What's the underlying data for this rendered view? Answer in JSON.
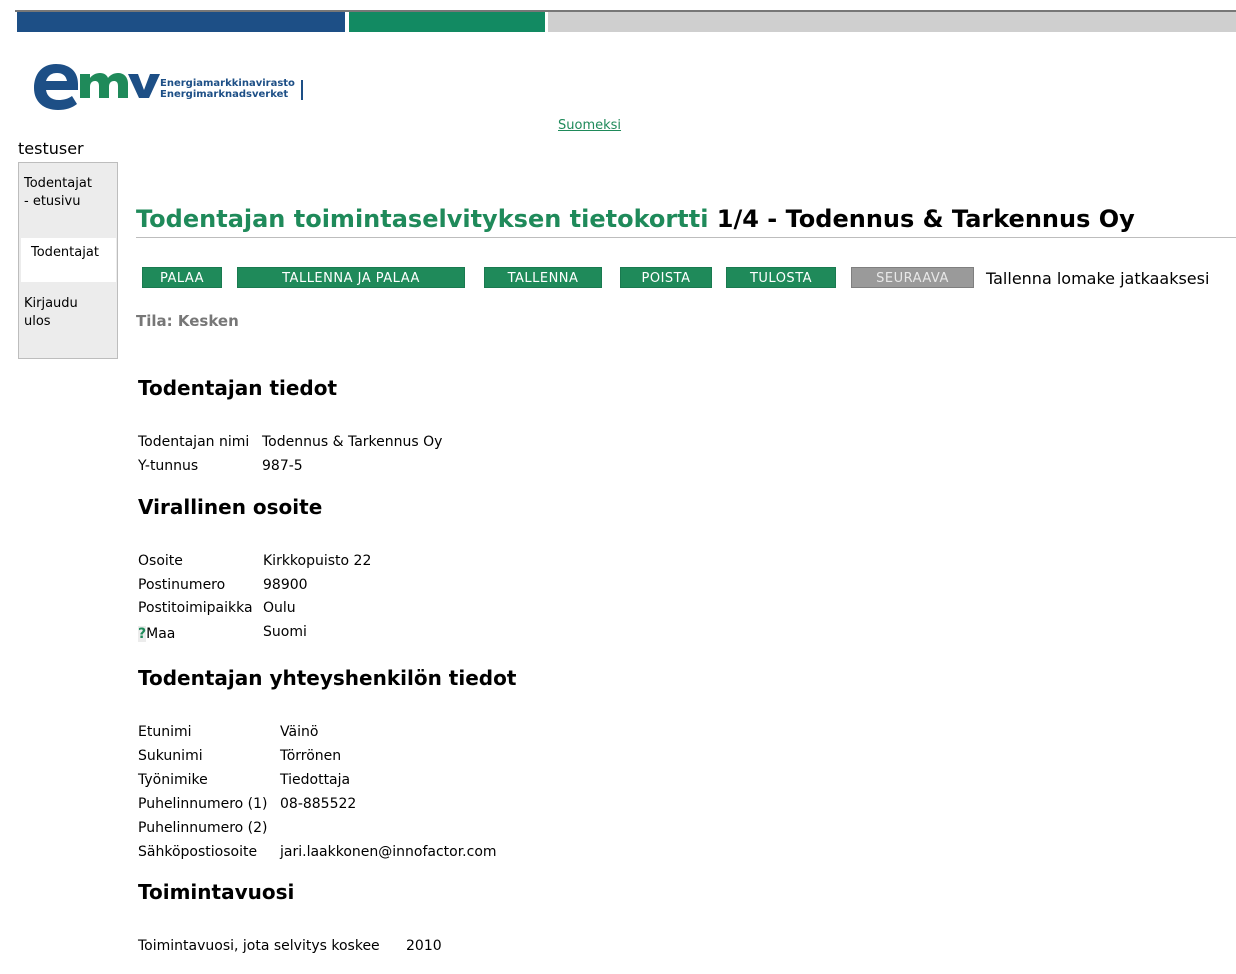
{
  "logo": {
    "mark": "emv",
    "name_fi": "Energiamarkkinavirasto",
    "name_sv": "Energimarknadsverket"
  },
  "language_link": "Suomeksi",
  "user": "testuser",
  "nav": {
    "items": [
      {
        "line1": "Todentajat",
        "line2": "- etusivu"
      },
      {
        "line1": "Todentajat",
        "line2": ""
      },
      {
        "line1": "Kirjaudu",
        "line2": "ulos"
      }
    ],
    "selected": "Todentajat"
  },
  "page": {
    "title_green": "Todentajan toimintaselvityksen tietokortti",
    "title_black": "1/4 - Todennus & Tarkennus Oy"
  },
  "buttons": {
    "back": "PALAA",
    "save_back": "TALLENNA JA PALAA",
    "save": "TALLENNA",
    "delete": "POISTA",
    "print": "TULOSTA",
    "next": "SEURAAVA"
  },
  "save_hint": "Tallenna lomake jatkaaksesi",
  "status": "Tila: Kesken",
  "sections": {
    "verifier": {
      "heading": "Todentajan tiedot",
      "name_label": "Todentajan nimi",
      "name_value": "Todennus & Tarkennus Oy",
      "id_label": "Y-tunnus",
      "id_value": "987-5"
    },
    "address": {
      "heading": "Virallinen osoite",
      "street_label": "Osoite",
      "street_value": "Kirkkopuisto 22",
      "zip_label": "Postinumero",
      "zip_value": "98900",
      "city_label": "Postitoimipaikka",
      "city_value": "Oulu",
      "help_mark": "?",
      "country_label": "Maa",
      "country_value": "Suomi"
    },
    "contact": {
      "heading": "Todentajan yhteyshenkilön tiedot",
      "first_label": "Etunimi",
      "first_value": "Väinö",
      "last_label": "Sukunimi",
      "last_value": "Törrönen",
      "role_label": "Työnimike",
      "role_value": "Tiedottaja",
      "phone1_label": "Puhelinnumero (1)",
      "phone1_value": "08-885522",
      "phone2_label": "Puhelinnumero (2)",
      "phone2_value": "",
      "email_label": "Sähköpostiosoite",
      "email_value": "jari.laakkonen@innofactor.com"
    },
    "year": {
      "heading": "Toimintavuosi",
      "label": "Toimintavuosi, jota selvitys koskee",
      "value": "2010"
    }
  },
  "colors": {
    "brand_green": "#1f8a5a",
    "brand_blue": "#1d4f86",
    "disabled_gray": "#9a9a9a"
  }
}
